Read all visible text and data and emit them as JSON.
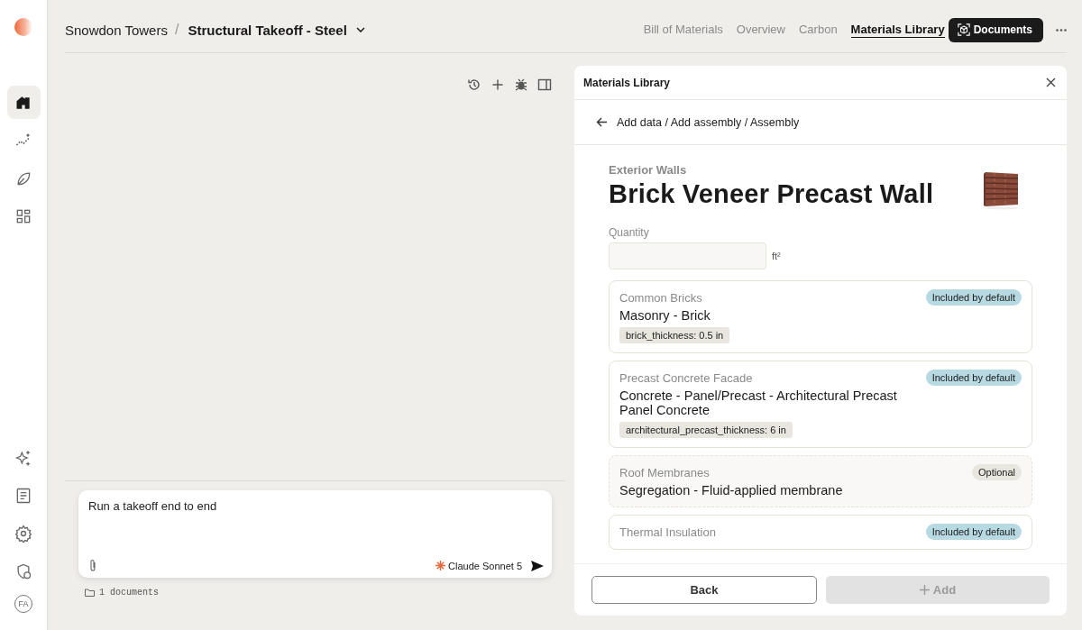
{
  "sidebar": {
    "top_items": [
      {
        "selected": true
      },
      {
        "selected": false
      },
      {
        "selected": false
      },
      {
        "selected": false
      }
    ],
    "avatar": "FA"
  },
  "breadcrumb": {
    "project": "Snowdon Towers",
    "separator": "/",
    "takeoff": "Structural Takeoff - Steel"
  },
  "tabs": [
    {
      "label": "Bill of Materials",
      "selected": false
    },
    {
      "label": "Overview",
      "selected": false
    },
    {
      "label": "Carbon",
      "selected": false
    },
    {
      "label": "Materials Library",
      "selected": true
    }
  ],
  "documents_button": "Documents",
  "chat": {
    "value": "Run a takeoff end to end",
    "model": "Claude Sonnet 5",
    "documents": "1 documents"
  },
  "panel": {
    "title": "Materials Library",
    "path": "Add data / Add assembly / Assembly",
    "category": "Exterior Walls",
    "title_main": "Brick Veneer Precast Wall",
    "quantity_label": "Quantity",
    "quantity_unit": "ft²",
    "materials": [
      {
        "category": "Common Bricks",
        "name": "Masonry - Brick",
        "badge": {
          "kind": "default",
          "label": "Included by default"
        },
        "param": "brick_thickness: 0.5 in"
      },
      {
        "category": "Precast Concrete Facade",
        "name": "Concrete - Panel/Precast - Architectural Precast Panel Concrete",
        "badge": {
          "kind": "default",
          "label": "Included by default"
        },
        "param": "architectural_precast_thickness: 6 in"
      },
      {
        "category": "Roof Membranes",
        "name": "Segregation - Fluid-applied membrane",
        "badge": {
          "kind": "optional",
          "label": "Optional"
        }
      },
      {
        "category": "Thermal Insulation",
        "badge": {
          "kind": "default",
          "label": "Included by default"
        }
      }
    ],
    "buttons": [
      {
        "label": "Back",
        "disabled": false
      },
      {
        "label": "Add",
        "disabled": true
      }
    ]
  }
}
